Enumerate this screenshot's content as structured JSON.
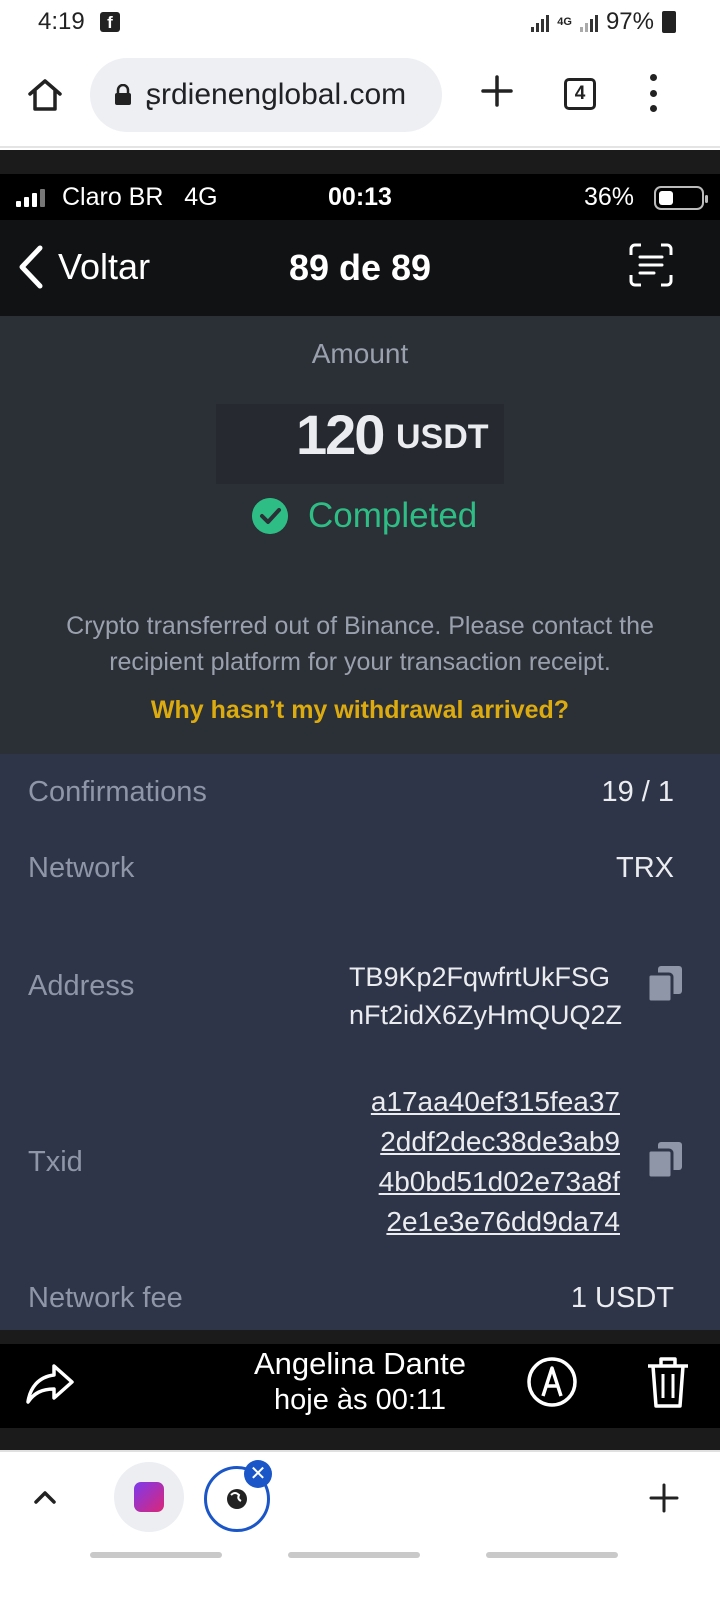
{
  "android_status": {
    "time": "4:19",
    "notif_icon": "facebook-icon",
    "net_label": "4G",
    "battery": "97%"
  },
  "browser": {
    "url": "erdienenglobal.com",
    "url_display": "ʂrdienenglobal.com",
    "tab_count": "4"
  },
  "ios_status": {
    "carrier": "Claro BR   4G",
    "time": "00:13",
    "battery": "36%"
  },
  "nav": {
    "back_label": "Voltar",
    "title": "89 de 89"
  },
  "transaction": {
    "amount_label": "Amount",
    "amount_value": "120",
    "amount_currency": "USDT",
    "status": "Completed",
    "status_color": "#2ebd85",
    "description": "Crypto transferred out of Binance. Please contact the recipient platform for your transaction receipt.",
    "help_link": "Why hasn’t my withdrawal arrived?",
    "help_link_color": "#f0b90b"
  },
  "details": {
    "confirmations_label": "Confirmations",
    "confirmations_value": "19 / 1",
    "network_label": "Network",
    "network_value": "TRX",
    "address_label": "Address",
    "address_line1": "TB9Kp2FqwfrtUkFSG",
    "address_line2": "nFt2idX6ZyHmQUQ2Z",
    "txid_label": "Txid",
    "txid_line1": "a17aa40ef315fea37",
    "txid_line2": "2ddf2dec38de3ab9",
    "txid_line3": "4b0bd51d02e73a8f",
    "txid_line4": "2e1e3e76dd9da74",
    "fee_label": "Network fee",
    "fee_value": "1 USDT"
  },
  "viewer": {
    "sender_name": "Angelina Dante",
    "sent_time": "hoje às 00:11"
  }
}
